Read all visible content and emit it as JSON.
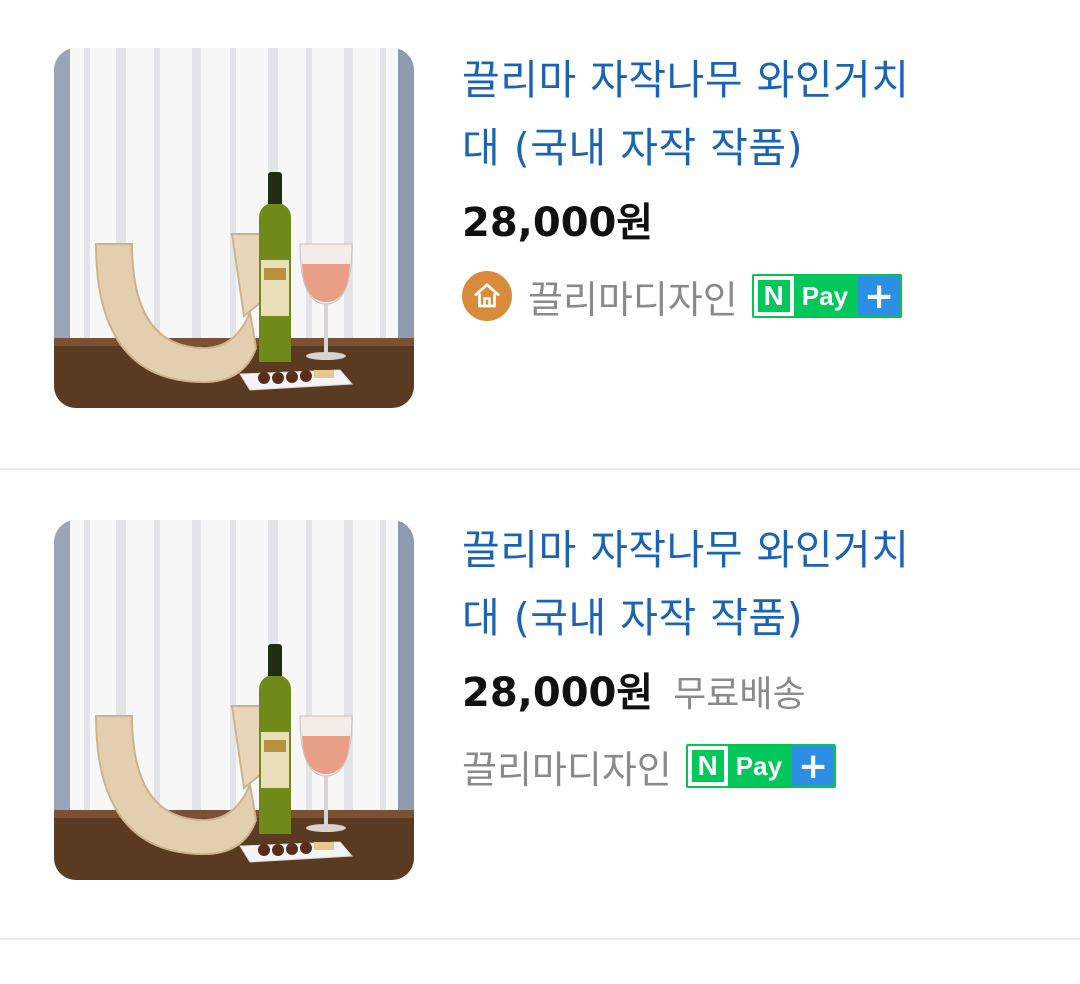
{
  "products": [
    {
      "title_line1": "끌리마 자작나무 와인거치",
      "title_line2": "대 (국내 자작 작품)",
      "price": "28,000원",
      "shipping": "",
      "seller": "끌리마디자인",
      "store_icon": "house-icon",
      "npay_n": "N",
      "npay_label": "Pay",
      "npay_plus": "+"
    },
    {
      "title_line1": "끌리마 자작나무 와인거치",
      "title_line2": "대 (국내 자작 작품)",
      "price": "28,000원",
      "shipping": "무료배송",
      "seller": "끌리마디자인",
      "npay_n": "N",
      "npay_label": "Pay",
      "npay_plus": "+"
    }
  ],
  "colors": {
    "title": "#1a63b5",
    "price": "#111111",
    "muted": "#8a8a8a",
    "npay_green": "#03c75a",
    "npay_plus_blue": "#2d8ee6",
    "store_icon_bg": "#d88b3a"
  }
}
